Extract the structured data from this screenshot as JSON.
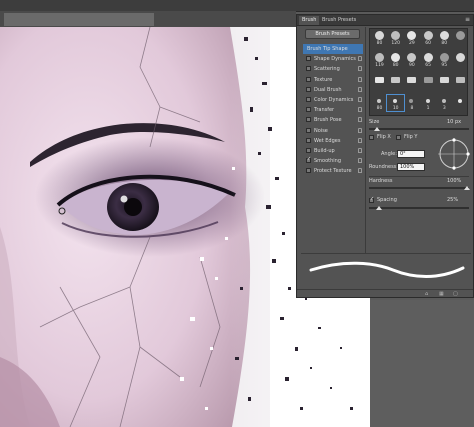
{
  "panel": {
    "tabs": [
      "Brush",
      "Brush Presets"
    ],
    "menu_icon": "panel-menu-icon",
    "presets_button": "Brush Presets",
    "options": [
      {
        "label": "Brush Tip Shape",
        "checked": false,
        "selected": true
      },
      {
        "label": "Shape Dynamics",
        "checked": false
      },
      {
        "label": "Scattering",
        "checked": false
      },
      {
        "label": "Texture",
        "checked": false
      },
      {
        "label": "Dual Brush",
        "checked": false
      },
      {
        "label": "Color Dynamics",
        "checked": false
      },
      {
        "label": "Transfer",
        "checked": false
      },
      {
        "label": "Brush Pose",
        "checked": false
      },
      {
        "label": "Noise",
        "checked": false
      },
      {
        "label": "Wet Edges",
        "checked": false
      },
      {
        "label": "Build-up",
        "checked": false
      },
      {
        "label": "Smoothing",
        "checked": true
      },
      {
        "label": "Protect Texture",
        "checked": false
      }
    ],
    "brush_grid": {
      "rows": [
        [
          "80",
          "120",
          "29",
          "60",
          "80",
          ""
        ],
        [
          "119",
          "80",
          "90",
          "65",
          "95",
          ""
        ],
        [
          "",
          "",
          "",
          "",
          "",
          ""
        ],
        [
          "80",
          "10",
          "8",
          "1",
          "3",
          ""
        ]
      ],
      "selected": [
        3,
        1
      ]
    },
    "size": {
      "label": "Size",
      "value": "10 px"
    },
    "flip_x": "Flip X",
    "flip_y": "Flip Y",
    "angle": {
      "label": "Angle:",
      "value": "0°"
    },
    "roundness": {
      "label": "Roundness:",
      "value": "100%"
    },
    "hardness": {
      "label": "Hardness",
      "value": "100%"
    },
    "spacing": {
      "label": "Spacing",
      "value": "25%",
      "checked": true
    }
  },
  "colors": {
    "accent": "#3f77b3",
    "panel": "#535353",
    "panel_dark": "#3a3a3a"
  }
}
